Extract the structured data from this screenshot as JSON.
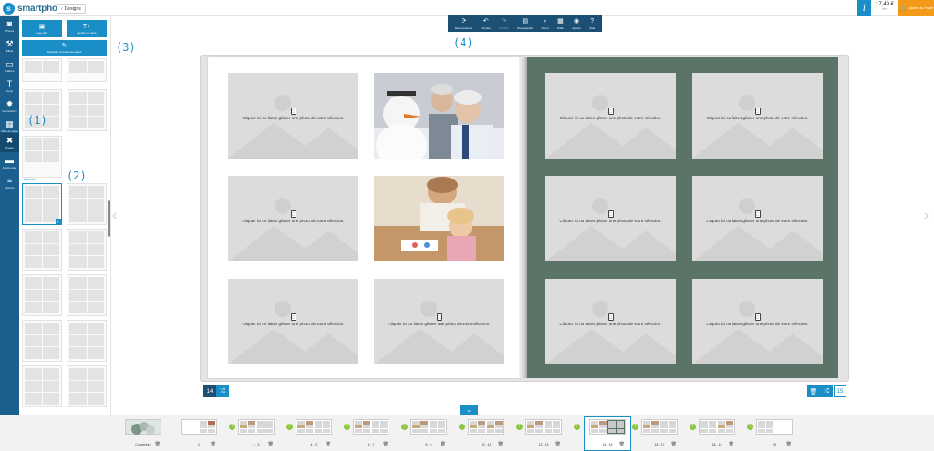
{
  "header": {
    "logo_text": "smartphoto",
    "back_label": "Designs",
    "info_label": "i",
    "price": "17,49 €",
    "price_sub": "dès",
    "cart_label": "Ajouter au Panier"
  },
  "rail": {
    "items": [
      {
        "label": "Photos",
        "icon": "camera-icon"
      },
      {
        "label": "Effets",
        "icon": "wand-icon"
      },
      {
        "label": "Cadres",
        "icon": "frame-icon"
      },
      {
        "label": "Texte",
        "icon": "text-icon"
      },
      {
        "label": "Décorations",
        "icon": "badge-icon"
      },
      {
        "label": "Mise en page",
        "icon": "layout-icon"
      },
      {
        "label": "Pages",
        "icon": "pages-icon"
      },
      {
        "label": "Arrière-plan",
        "icon": "background-icon"
      },
      {
        "label": "Options",
        "icon": "menu-icon"
      }
    ]
  },
  "panel": {
    "btn_auto": "Lay-outs",
    "btn_text": "Ajouter du texte",
    "btn_apply": "Appliquer à toutes les pages",
    "section_label": "6 photos"
  },
  "callouts": {
    "one": "(1)",
    "two": "(2)",
    "three": "(3)",
    "four": "(4)"
  },
  "toolbar": {
    "items": [
      {
        "label": "Recommencer",
        "icon": "reload-icon"
      },
      {
        "label": "Annuler",
        "icon": "undo-icon"
      },
      {
        "label": "Rétablir",
        "icon": "redo-icon"
      },
      {
        "label": "Sauvegarder",
        "icon": "save-icon"
      },
      {
        "label": "Zoom",
        "icon": "zoom-icon"
      },
      {
        "label": "Grille",
        "icon": "grid-icon"
      },
      {
        "label": "Aperçu",
        "icon": "eye-icon"
      },
      {
        "label": "Aide",
        "icon": "help-icon"
      }
    ]
  },
  "book": {
    "placeholder_text": "Cliquez ici ou faites glisser une photo de votre sélection.",
    "left_page_number": "14",
    "right_page_number": "15"
  },
  "filmstrip": {
    "items": [
      {
        "label": "Couverture"
      },
      {
        "label": "1"
      },
      {
        "label": "2 - 3"
      },
      {
        "label": "4 - 5"
      },
      {
        "label": "6 - 7"
      },
      {
        "label": "8 - 9"
      },
      {
        "label": "10 - 11"
      },
      {
        "label": "12 - 13"
      },
      {
        "label": "14 - 15"
      },
      {
        "label": "16 - 17"
      },
      {
        "label": "18 - 19"
      },
      {
        "label": "20"
      }
    ]
  },
  "colors": {
    "accent": "#1a8ec6",
    "rail": "#1a5f8e",
    "right_page": "#5c7468",
    "cart": "#f39b19"
  }
}
